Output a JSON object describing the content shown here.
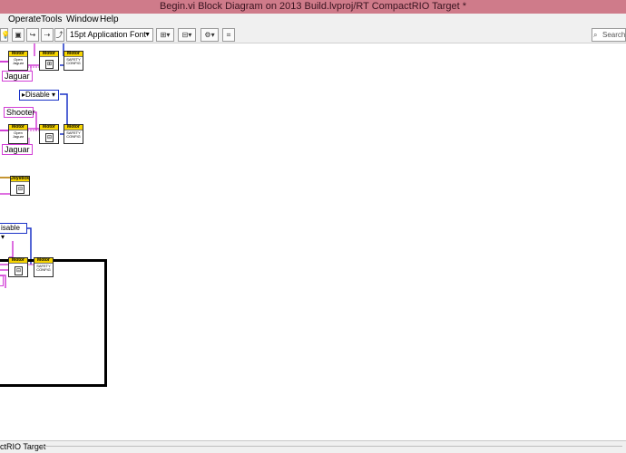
{
  "window": {
    "title": "Begin.vi Block Diagram on 2013 Build.lvproj/RT CompactRIO Target *"
  },
  "menu": [
    "Operate",
    "Tools",
    "Window",
    "Help"
  ],
  "toolbar": {
    "font": "15pt Application Font",
    "search_placeholder": "Search"
  },
  "diagram": {
    "motor_label": "Motor",
    "open_jaguar": "Open Jaguar",
    "safety_config": "SAFETY CONFIG",
    "joystick_label": "Joystick",
    "jaguar_label": "Jaguar",
    "shooter_label": "Shooter",
    "disable_label": "Disable",
    "disable_partial": "isable"
  },
  "status": {
    "target": "ctRIO Target"
  }
}
